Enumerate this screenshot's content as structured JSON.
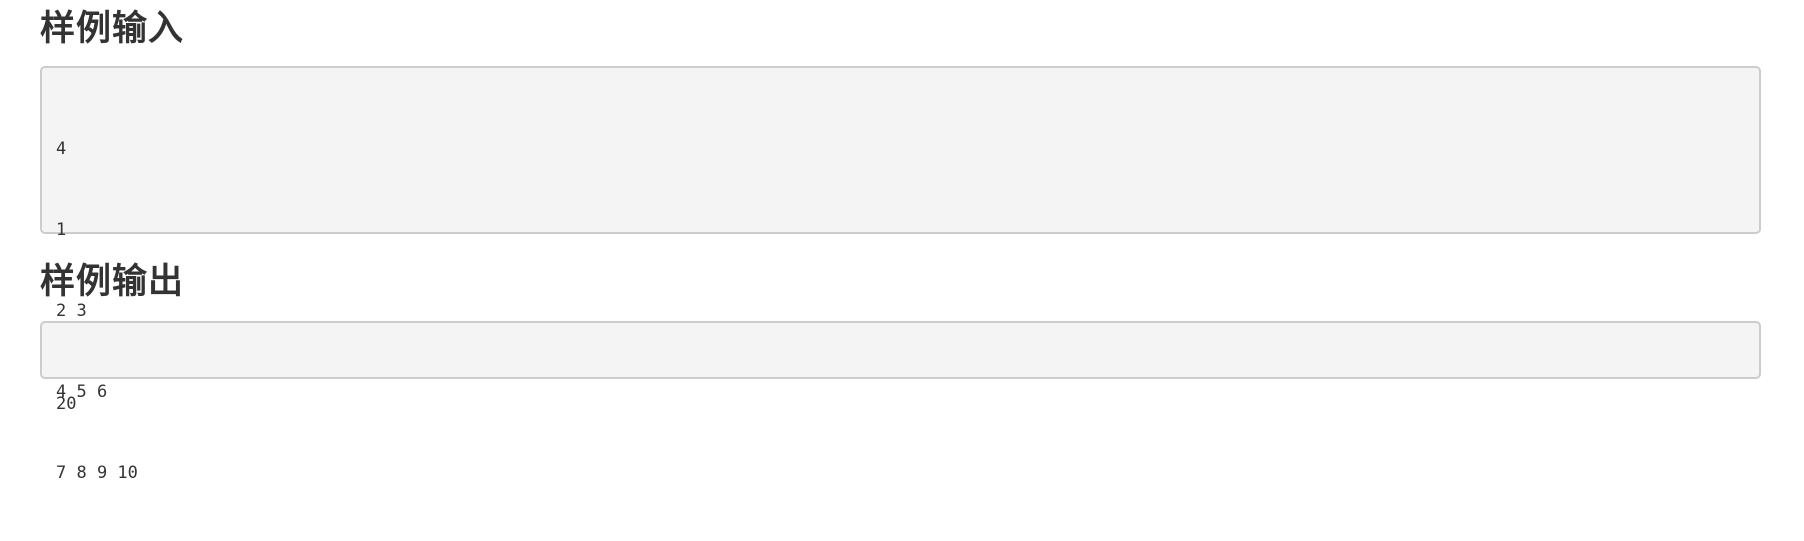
{
  "sample_input": {
    "title": "样例输入",
    "lines": [
      "4",
      "1",
      "2 3",
      "4 5 6",
      "7 8 9 10"
    ]
  },
  "sample_output": {
    "title": "样例输出",
    "lines": [
      "20"
    ]
  }
}
